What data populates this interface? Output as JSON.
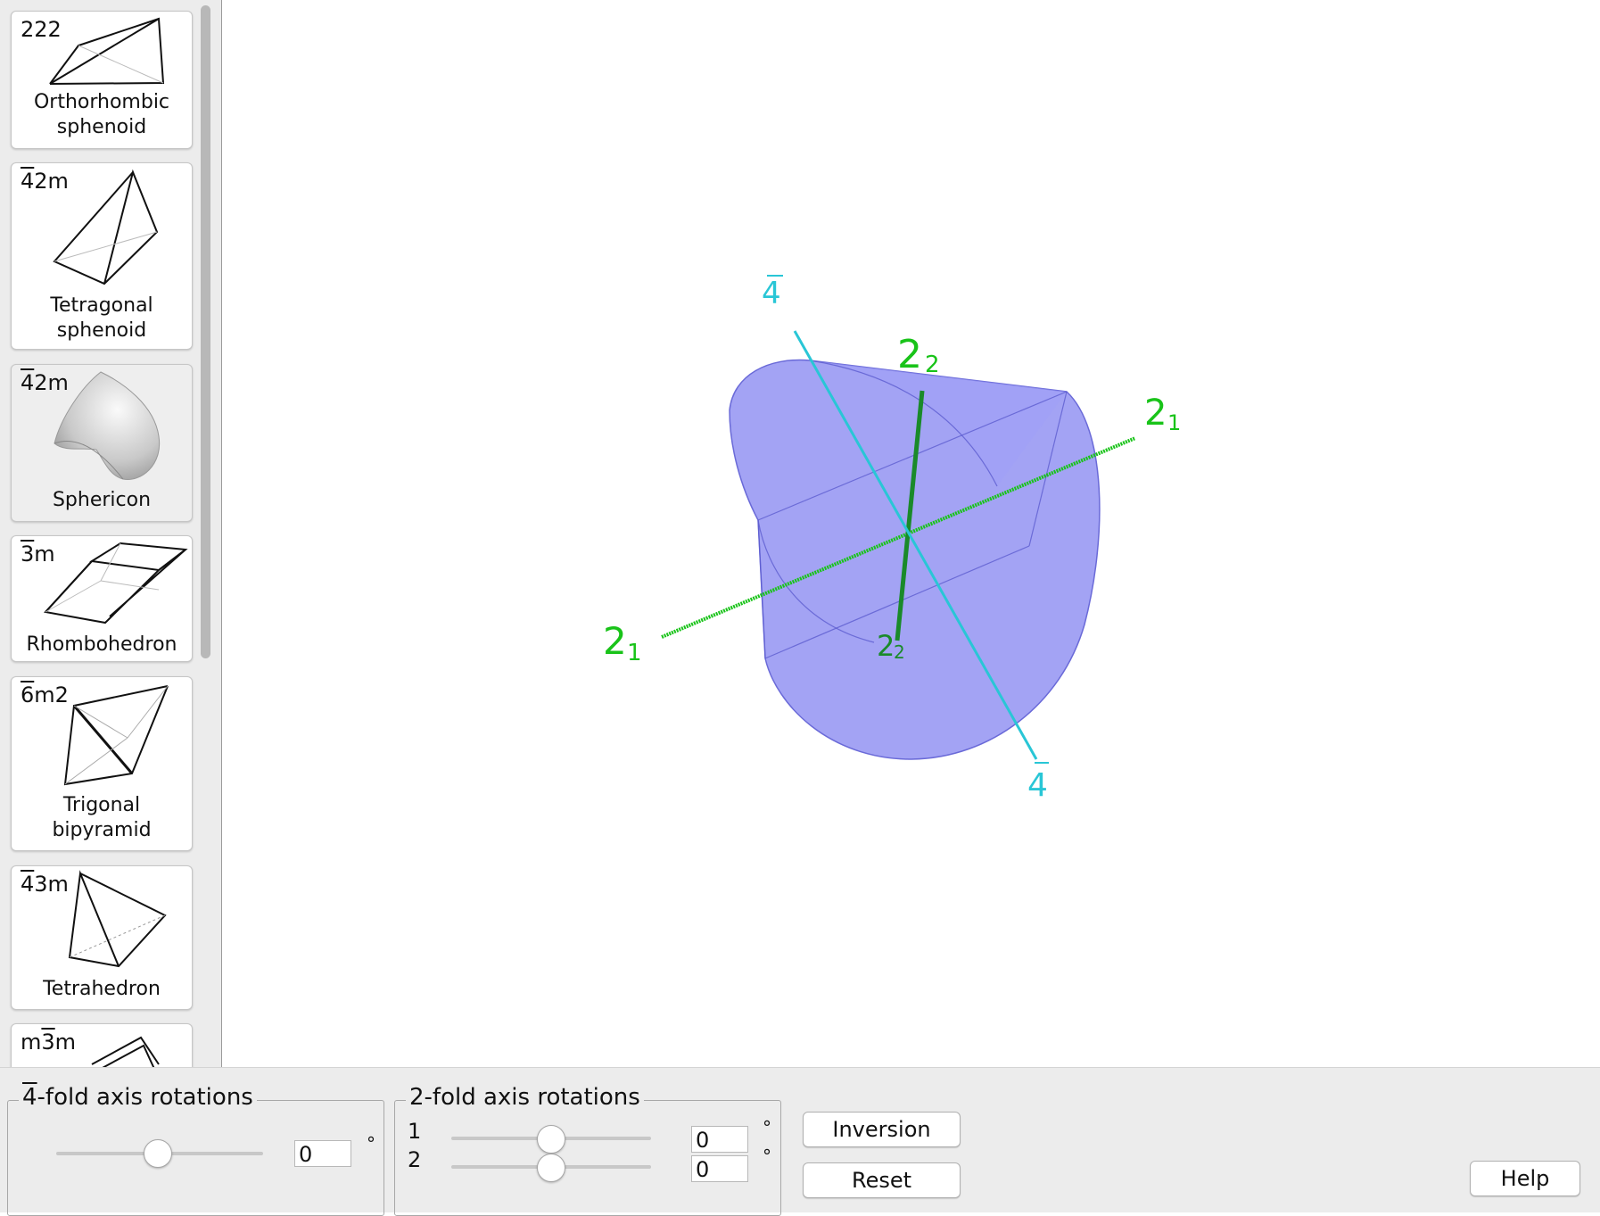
{
  "sidebar": {
    "cards": [
      {
        "symbol_pre": "222",
        "symbol_bar": "",
        "symbol_post": "",
        "name": "Orthorhombic\nsphenoid",
        "icon": "orthorhombic-sphenoid-icon"
      },
      {
        "symbol_pre": "",
        "symbol_bar": "4",
        "symbol_post": "2m",
        "name": "Tetragonal\nsphenoid",
        "icon": "tetragonal-sphenoid-icon"
      },
      {
        "symbol_pre": "",
        "symbol_bar": "4",
        "symbol_post": "2m",
        "name": "Sphericon",
        "icon": "sphericon-icon"
      },
      {
        "symbol_pre": "",
        "symbol_bar": "3",
        "symbol_post": "m",
        "name": "Rhombohedron",
        "icon": "rhombohedron-icon"
      },
      {
        "symbol_pre": "",
        "symbol_bar": "6",
        "symbol_post": "m2",
        "name": "Trigonal\nbipyramid",
        "icon": "trigonal-bipyramid-icon"
      },
      {
        "symbol_pre": "",
        "symbol_bar": "4",
        "symbol_post": "3m",
        "name": "Tetrahedron",
        "icon": "tetrahedron-icon"
      },
      {
        "symbol_pre": "m",
        "symbol_bar": "3",
        "symbol_post": "m",
        "name": "",
        "icon": "cube-octahedron-icon"
      }
    ],
    "selected_index": 2
  },
  "viewer": {
    "axis_labels": {
      "fourbar_top": "4",
      "fourbar_bottom": "4",
      "two_2_top_main": "2",
      "two_2_top_sub": "2",
      "two_2_bottom_main": "2",
      "two_2_bottom_sub": "2",
      "two_1_right_main": "2",
      "two_1_right_sub": "1",
      "two_1_left_main": "2",
      "two_1_left_sub": "1"
    },
    "colors": {
      "fourbar_axis": "#29c6d6",
      "twofold_axis": "#19c319",
      "solid": "#8f8ff2"
    }
  },
  "controls": {
    "fourfold_group": {
      "title_bar": "4",
      "title_rest": "-fold axis rotations",
      "value": "0",
      "unit": "°",
      "slider_fraction": 0.5
    },
    "twofold_group": {
      "title": "2-fold axis rotations",
      "rows": [
        {
          "label": "1",
          "value": "0",
          "unit": "°",
          "slider_fraction": 0.5
        },
        {
          "label": "2",
          "value": "0",
          "unit": "°",
          "slider_fraction": 0.5
        }
      ]
    },
    "buttons": {
      "inversion": "Inversion",
      "reset": "Reset",
      "help": "Help"
    }
  }
}
